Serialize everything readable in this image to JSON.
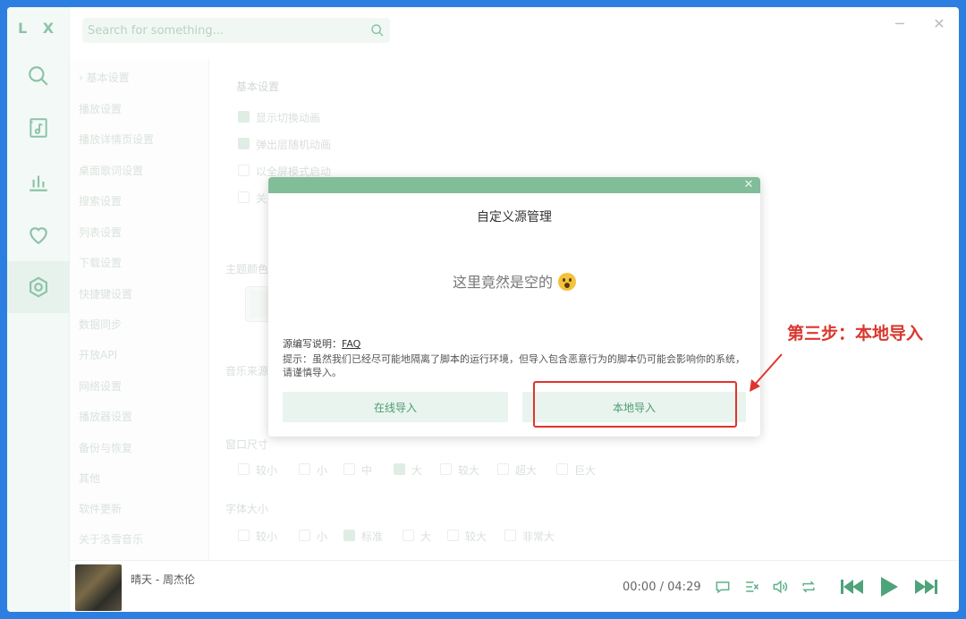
{
  "app": {
    "logo": "L X"
  },
  "search": {
    "placeholder": "Search for something..."
  },
  "window": {
    "minimize": "─",
    "close": "✕"
  },
  "nav": [
    {
      "name": "search-icon"
    },
    {
      "name": "music-library-icon"
    },
    {
      "name": "leaderboard-icon"
    },
    {
      "name": "heart-icon"
    },
    {
      "name": "settings-icon"
    }
  ],
  "settings_menu": [
    "› 基本设置",
    "播放设置",
    "播放详情页设置",
    "桌面歌词设置",
    "搜索设置",
    "列表设置",
    "下载设置",
    "快捷键设置",
    "数据同步",
    "开放API",
    "网络设置",
    "播放器设置",
    "备份与恢复",
    "其他",
    "软件更新",
    "关于洛雪音乐"
  ],
  "content": {
    "section_basic": "基本设置",
    "opt_show_anim": "显示切换动画",
    "opt_popup_anim": "弹出层随机动画",
    "opt_fullscreen": "以全屏模式启动",
    "opt_close": "关",
    "label_theme": "主题颜色",
    "label_source": "音乐来源",
    "label_window_size": "窗口尺寸",
    "window_sizes": [
      "较小",
      "小",
      "中",
      "大",
      "较大",
      "超大",
      "巨大"
    ],
    "label_font_size": "字体大小",
    "font_sizes": [
      "较小",
      "小",
      "标准",
      "大",
      "较大",
      "非常大"
    ]
  },
  "dialog": {
    "close": "✕",
    "title": "自定义源管理",
    "empty_text": "这里竟然是空的",
    "note_label": "源编写说明：",
    "note_link": "FAQ",
    "tip": "提示：虽然我们已经尽可能地隔离了脚本的运行环境，但导入包含恶意行为的脚本仍可能会影响你的系统，请谨慎导入。",
    "online_import": "在线导入",
    "local_import": "本地导入"
  },
  "annotation": {
    "text": "第三步：本地导入",
    "color": "#d9382e"
  },
  "player": {
    "song": "晴天 - 周杰伦",
    "current_time": "00:00",
    "separator": "/",
    "duration": "04:29"
  },
  "colors": {
    "accent": "#4fa37a",
    "dialog_bar": "#80bd98",
    "highlight": "#e0342f"
  }
}
